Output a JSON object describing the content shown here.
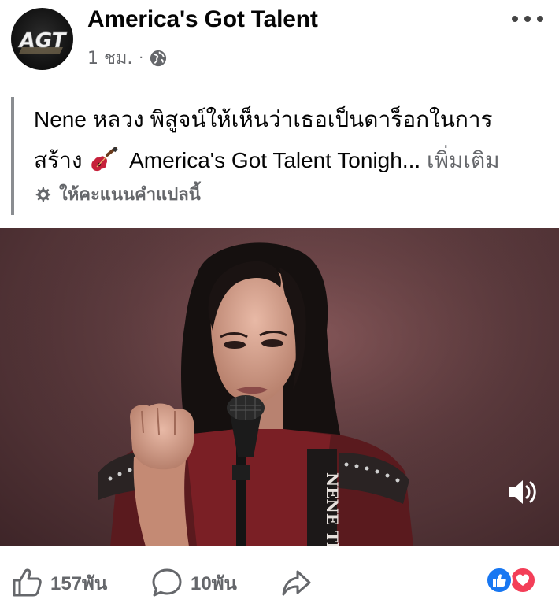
{
  "post": {
    "page_name": "America's Got Talent",
    "avatar_text": "AGT",
    "time": "1 ชม.",
    "separator": "·",
    "audience_icon": "globe-icon",
    "menu_icon": "more-horizontal-icon"
  },
  "body": {
    "text_part1": "Nene หลวง พิสูจน์ให้เห็นว่าเธอเป็นดาร็อกในการสร้าง",
    "emoji": "guitar-emoji",
    "text_part2": "America's Got Talent Tonigh...",
    "see_more": "เพิ่มเติม",
    "translate_label": "ให้คะแนนคำแปลนี้",
    "translate_icon": "gear-icon"
  },
  "video": {
    "volume_icon": "speaker-icon",
    "jacket_text": "NENE Thai"
  },
  "actions": {
    "like_count": "157พัน",
    "comment_count": "10พัน",
    "like_icon": "thumbs-up-icon",
    "comment_icon": "comment-icon",
    "share_icon": "share-icon"
  },
  "reactions": {
    "like_color": "#1877f2",
    "love_color": "#f33e58"
  }
}
